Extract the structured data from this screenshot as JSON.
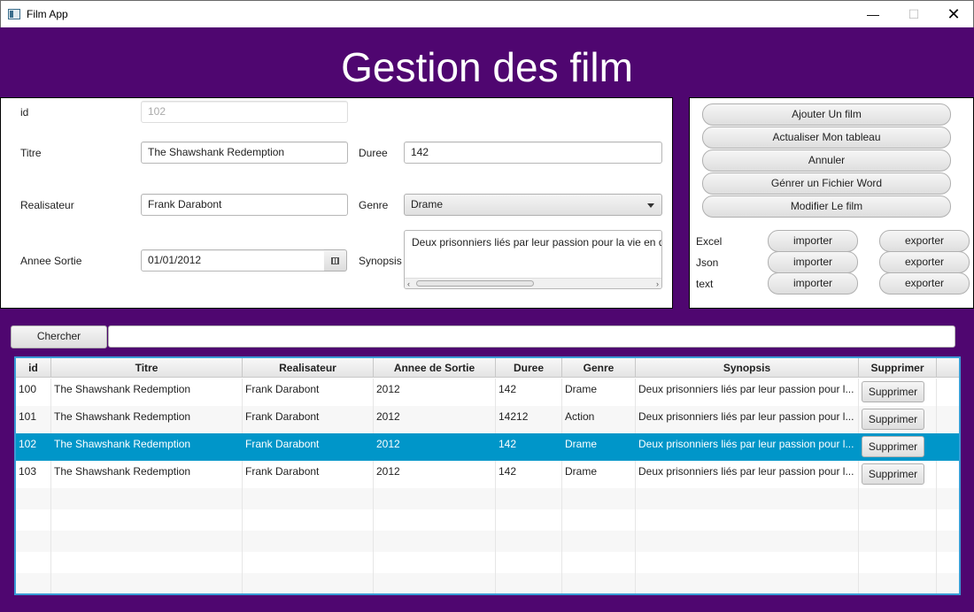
{
  "window": {
    "title": "Film App",
    "minimize": "—",
    "maximize": "☐",
    "close": "✕"
  },
  "heading": "Gestion des film",
  "form": {
    "id_label": "id",
    "id_value": "102",
    "titre_label": "Titre",
    "titre_value": "The Shawshank Redemption",
    "duree_label": "Duree",
    "duree_value": "142",
    "realisateur_label": "Realisateur",
    "realisateur_value": "Frank Darabont",
    "genre_label": "Genre",
    "genre_value": "Drame",
    "annee_label": "Annee Sortie",
    "annee_value": "01/01/2012",
    "synopsis_label": "Synopsis",
    "synopsis_value": "Deux prisonniers liés par leur passion pour la vie en d"
  },
  "actions": {
    "ajouter": "Ajouter Un film",
    "actualiser": "Actualiser Mon tableau",
    "annuler": "Annuler",
    "word": "Génrer un Fichier Word",
    "modifier": "Modifier Le film",
    "formats": [
      {
        "label": "Excel",
        "import": "importer",
        "export": "exporter"
      },
      {
        "label": "Json",
        "import": "importer",
        "export": "exporter"
      },
      {
        "label": "text",
        "import": "importer",
        "export": "exporter"
      }
    ]
  },
  "search": {
    "button": "Chercher",
    "value": ""
  },
  "table": {
    "columns": [
      "id",
      "Titre",
      "Realisateur",
      "Annee de Sortie",
      "Duree",
      "Genre",
      "Synopsis",
      "Supprimer"
    ],
    "rows": [
      {
        "id": "100",
        "titre": "The Shawshank Redemption",
        "realisateur": "Frank Darabont",
        "annee": "2012",
        "duree": "142",
        "genre": "Drame",
        "synopsis": "Deux prisonniers liés par leur passion pour l...",
        "supprimer": "Supprimer"
      },
      {
        "id": "101",
        "titre": "The Shawshank Redemption",
        "realisateur": "Frank Darabont",
        "annee": "2012",
        "duree": "14212",
        "genre": "Action",
        "synopsis": "Deux prisonniers liés par leur passion pour l...",
        "supprimer": "Supprimer"
      },
      {
        "id": "102",
        "titre": "The Shawshank Redemption",
        "realisateur": "Frank Darabont",
        "annee": "2012",
        "duree": "142",
        "genre": "Drame",
        "synopsis": "Deux prisonniers liés par leur passion pour l...",
        "supprimer": "Supprimer"
      },
      {
        "id": "103",
        "titre": "The Shawshank Redemption",
        "realisateur": "Frank Darabont",
        "annee": "2012",
        "duree": "142",
        "genre": "Drame",
        "synopsis": "Deux prisonniers liés par leur passion pour l...",
        "supprimer": "Supprimer"
      }
    ],
    "selected_row": "102"
  },
  "colors": {
    "background": "#4f0670",
    "selection": "#0096c9",
    "table_border": "#3a9bd6"
  }
}
